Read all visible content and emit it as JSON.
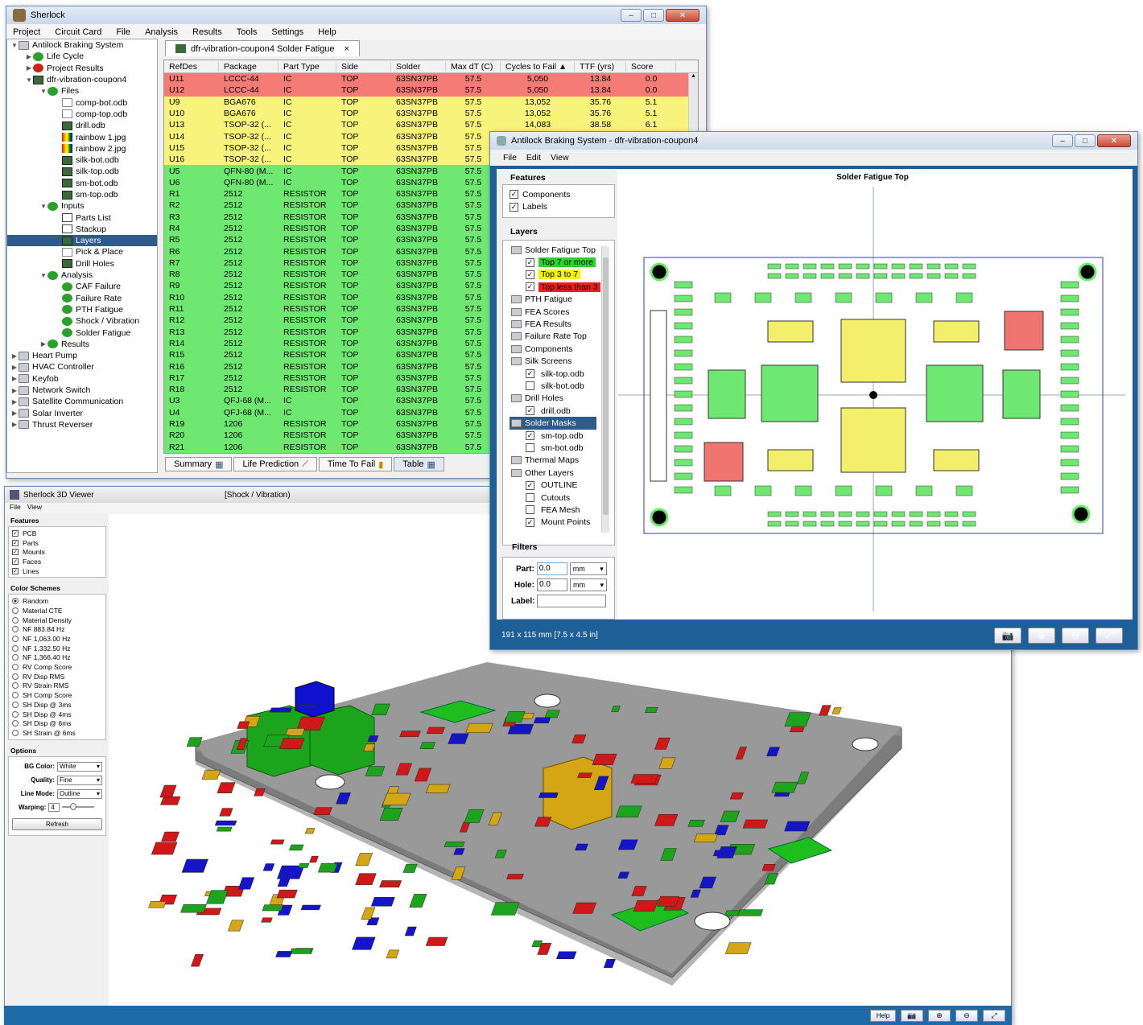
{
  "main_window": {
    "title": "Sherlock",
    "menu": [
      "Project",
      "Circuit Card",
      "File",
      "Analysis",
      "Results",
      "Tools",
      "Settings",
      "Help"
    ],
    "tab_title": "dfr-vibration-coupon4 Solder Fatigue",
    "tab_close": "×",
    "tree": [
      {
        "label": "Antilock Braking System",
        "indent": 0,
        "icon": "folder",
        "tw": "▼"
      },
      {
        "label": "Life Cycle",
        "indent": 1,
        "icon": "ok",
        "tw": "▶"
      },
      {
        "label": "Project Results",
        "indent": 1,
        "icon": "err",
        "tw": "▶"
      },
      {
        "label": "dfr-vibration-coupon4",
        "indent": 1,
        "icon": "board",
        "tw": "▼"
      },
      {
        "label": "Files",
        "indent": 2,
        "icon": "ok",
        "tw": "▼"
      },
      {
        "label": "comp-bot.odb",
        "indent": 3,
        "icon": "file",
        "tw": ""
      },
      {
        "label": "comp-top.odb",
        "indent": 3,
        "icon": "file",
        "tw": ""
      },
      {
        "label": "drill.odb",
        "indent": 3,
        "icon": "board",
        "tw": ""
      },
      {
        "label": "rainbow 1.jpg",
        "indent": 3,
        "icon": "img",
        "tw": ""
      },
      {
        "label": "rainbow 2.jpg",
        "indent": 3,
        "icon": "img",
        "tw": ""
      },
      {
        "label": "silk-bot.odb",
        "indent": 3,
        "icon": "board",
        "tw": ""
      },
      {
        "label": "silk-top.odb",
        "indent": 3,
        "icon": "board",
        "tw": ""
      },
      {
        "label": "sm-bot.odb",
        "indent": 3,
        "icon": "board",
        "tw": ""
      },
      {
        "label": "sm-top.odb",
        "indent": 3,
        "icon": "board",
        "tw": ""
      },
      {
        "label": "Inputs",
        "indent": 2,
        "icon": "ok",
        "tw": "▼"
      },
      {
        "label": "Parts List",
        "indent": 3,
        "icon": "tbl",
        "tw": ""
      },
      {
        "label": "Stackup",
        "indent": 3,
        "icon": "tbl",
        "tw": ""
      },
      {
        "label": "Layers",
        "indent": 3,
        "icon": "board",
        "tw": "",
        "selected": true
      },
      {
        "label": "Pick & Place",
        "indent": 3,
        "icon": "file",
        "tw": ""
      },
      {
        "label": "Drill Holes",
        "indent": 3,
        "icon": "board",
        "tw": ""
      },
      {
        "label": "Analysis",
        "indent": 2,
        "icon": "ok",
        "tw": "▼"
      },
      {
        "label": "CAF Failure",
        "indent": 3,
        "icon": "ok",
        "tw": ""
      },
      {
        "label": "Failure Rate",
        "indent": 3,
        "icon": "ok",
        "tw": ""
      },
      {
        "label": "PTH Fatigue",
        "indent": 3,
        "icon": "ok",
        "tw": ""
      },
      {
        "label": "Shock / Vibration",
        "indent": 3,
        "icon": "ok",
        "tw": ""
      },
      {
        "label": "Solder Fatigue",
        "indent": 3,
        "icon": "ok",
        "tw": ""
      },
      {
        "label": "Results",
        "indent": 2,
        "icon": "ok",
        "tw": "▶"
      },
      {
        "label": "Heart Pump",
        "indent": 0,
        "icon": "folder",
        "tw": "▶"
      },
      {
        "label": "HVAC Controller",
        "indent": 0,
        "icon": "folder",
        "tw": "▶"
      },
      {
        "label": "Keyfob",
        "indent": 0,
        "icon": "folder",
        "tw": "▶"
      },
      {
        "label": "Network Switch",
        "indent": 0,
        "icon": "folder",
        "tw": "▶"
      },
      {
        "label": "Satellite Communication",
        "indent": 0,
        "icon": "folder",
        "tw": "▶"
      },
      {
        "label": "Solar Inverter",
        "indent": 0,
        "icon": "folder",
        "tw": "▶"
      },
      {
        "label": "Thrust Reverser",
        "indent": 0,
        "icon": "folder",
        "tw": "▶"
      }
    ],
    "columns": [
      "RefDes",
      "Package",
      "Part Type",
      "Side",
      "Solder",
      "Max dT (C)",
      "Cycles to Fail ▲",
      "TTF (yrs)",
      "Score"
    ],
    "rows": [
      [
        "U11",
        "LCCC-44",
        "IC",
        "TOP",
        "63SN37PB",
        "57.5",
        "5,050",
        "13.84",
        "0.0",
        "red"
      ],
      [
        "U12",
        "LCCC-44",
        "IC",
        "TOP",
        "63SN37PB",
        "57.5",
        "5,050",
        "13.84",
        "0.0",
        "red"
      ],
      [
        "U9",
        "BGA676",
        "IC",
        "TOP",
        "63SN37PB",
        "57.5",
        "13,052",
        "35.76",
        "5.1",
        "yel"
      ],
      [
        "U10",
        "BGA676",
        "IC",
        "TOP",
        "63SN37PB",
        "57.5",
        "13,052",
        "35.76",
        "5.1",
        "yel"
      ],
      [
        "U13",
        "TSOP-32 (...",
        "IC",
        "TOP",
        "63SN37PB",
        "57.5",
        "14,083",
        "38.58",
        "6.1",
        "yel"
      ],
      [
        "U14",
        "TSOP-32 (...",
        "IC",
        "TOP",
        "63SN37PB",
        "57.5",
        "",
        "",
        "",
        "yel"
      ],
      [
        "U15",
        "TSOP-32 (...",
        "IC",
        "TOP",
        "63SN37PB",
        "57.5",
        "",
        "",
        "",
        "yel"
      ],
      [
        "U16",
        "TSOP-32 (...",
        "IC",
        "TOP",
        "63SN37PB",
        "57.5",
        "",
        "",
        "",
        "yel"
      ],
      [
        "U5",
        "QFN-80 (M...",
        "IC",
        "TOP",
        "63SN37PB",
        "57.5",
        "",
        "",
        "",
        "grn"
      ],
      [
        "U6",
        "QFN-80 (M...",
        "IC",
        "TOP",
        "63SN37PB",
        "57.5",
        "",
        "",
        "",
        "grn"
      ],
      [
        "R1",
        "2512",
        "RESISTOR",
        "TOP",
        "63SN37PB",
        "57.5",
        "",
        "",
        "",
        "grn"
      ],
      [
        "R2",
        "2512",
        "RESISTOR",
        "TOP",
        "63SN37PB",
        "57.5",
        "",
        "",
        "",
        "grn"
      ],
      [
        "R3",
        "2512",
        "RESISTOR",
        "TOP",
        "63SN37PB",
        "57.5",
        "",
        "",
        "",
        "grn"
      ],
      [
        "R4",
        "2512",
        "RESISTOR",
        "TOP",
        "63SN37PB",
        "57.5",
        "",
        "",
        "",
        "grn"
      ],
      [
        "R5",
        "2512",
        "RESISTOR",
        "TOP",
        "63SN37PB",
        "57.5",
        "",
        "",
        "",
        "grn"
      ],
      [
        "R6",
        "2512",
        "RESISTOR",
        "TOP",
        "63SN37PB",
        "57.5",
        "",
        "",
        "",
        "grn"
      ],
      [
        "R7",
        "2512",
        "RESISTOR",
        "TOP",
        "63SN37PB",
        "57.5",
        "",
        "",
        "",
        "grn"
      ],
      [
        "R8",
        "2512",
        "RESISTOR",
        "TOP",
        "63SN37PB",
        "57.5",
        "",
        "",
        "",
        "grn"
      ],
      [
        "R9",
        "2512",
        "RESISTOR",
        "TOP",
        "63SN37PB",
        "57.5",
        "",
        "",
        "",
        "grn"
      ],
      [
        "R10",
        "2512",
        "RESISTOR",
        "TOP",
        "63SN37PB",
        "57.5",
        "",
        "",
        "",
        "grn"
      ],
      [
        "R11",
        "2512",
        "RESISTOR",
        "TOP",
        "63SN37PB",
        "57.5",
        "",
        "",
        "",
        "grn"
      ],
      [
        "R12",
        "2512",
        "RESISTOR",
        "TOP",
        "63SN37PB",
        "57.5",
        "",
        "",
        "",
        "grn"
      ],
      [
        "R13",
        "2512",
        "RESISTOR",
        "TOP",
        "63SN37PB",
        "57.5",
        "",
        "",
        "",
        "grn"
      ],
      [
        "R14",
        "2512",
        "RESISTOR",
        "TOP",
        "63SN37PB",
        "57.5",
        "",
        "",
        "",
        "grn"
      ],
      [
        "R15",
        "2512",
        "RESISTOR",
        "TOP",
        "63SN37PB",
        "57.5",
        "",
        "",
        "",
        "grn"
      ],
      [
        "R16",
        "2512",
        "RESISTOR",
        "TOP",
        "63SN37PB",
        "57.5",
        "",
        "",
        "",
        "grn"
      ],
      [
        "R17",
        "2512",
        "RESISTOR",
        "TOP",
        "63SN37PB",
        "57.5",
        "",
        "",
        "",
        "grn"
      ],
      [
        "R18",
        "2512",
        "RESISTOR",
        "TOP",
        "63SN37PB",
        "57.5",
        "",
        "",
        "",
        "grn"
      ],
      [
        "U3",
        "QFJ-68 (M...",
        "IC",
        "TOP",
        "63SN37PB",
        "57.5",
        "",
        "",
        "",
        "grn"
      ],
      [
        "U4",
        "QFJ-68 (M...",
        "IC",
        "TOP",
        "63SN37PB",
        "57.5",
        "",
        "",
        "",
        "grn"
      ],
      [
        "R19",
        "1206",
        "RESISTOR",
        "TOP",
        "63SN37PB",
        "57.5",
        "",
        "",
        "",
        "grn"
      ],
      [
        "R20",
        "1206",
        "RESISTOR",
        "TOP",
        "63SN37PB",
        "57.5",
        "",
        "",
        "",
        "grn"
      ],
      [
        "R21",
        "1206",
        "RESISTOR",
        "TOP",
        "63SN37PB",
        "57.5",
        "",
        "",
        "",
        "grn"
      ]
    ],
    "bottom_tabs": [
      "Summary",
      "Life Prediction",
      "Time To Fail",
      "Table"
    ]
  },
  "layout_window": {
    "title": "Antilock Braking System - dfr-vibration-coupon4",
    "menu": [
      "File",
      "Edit",
      "View"
    ],
    "features_label": "Features",
    "features": [
      {
        "label": "Components",
        "checked": true
      },
      {
        "label": "Labels",
        "checked": true
      }
    ],
    "layers_label": "Layers",
    "layers": [
      {
        "label": "Solder Fatigue Top",
        "kind": "folder"
      },
      {
        "label": "Top 7 or more",
        "kind": "check",
        "checked": true,
        "color": "#2bd42b"
      },
      {
        "label": "Top 3 to 7",
        "kind": "check",
        "checked": true,
        "color": "#f4f400"
      },
      {
        "label": "Top less than 3",
        "kind": "check",
        "checked": true,
        "color": "#f01c1c"
      },
      {
        "label": "PTH Fatigue",
        "kind": "folder"
      },
      {
        "label": "FEA Scores",
        "kind": "folder"
      },
      {
        "label": "FEA Results",
        "kind": "folder"
      },
      {
        "label": "Failure Rate Top",
        "kind": "folder"
      },
      {
        "label": "Components",
        "kind": "folder"
      },
      {
        "label": "Silk Screens",
        "kind": "folder"
      },
      {
        "label": "silk-top.odb",
        "kind": "check",
        "checked": true
      },
      {
        "label": "silk-bot.odb",
        "kind": "check",
        "checked": false
      },
      {
        "label": "Drill Holes",
        "kind": "folder"
      },
      {
        "label": "drill.odb",
        "kind": "check",
        "checked": true
      },
      {
        "label": "Solder Masks",
        "kind": "folder",
        "selected": true
      },
      {
        "label": "sm-top.odb",
        "kind": "check",
        "checked": true
      },
      {
        "label": "sm-bot.odb",
        "kind": "check",
        "checked": false
      },
      {
        "label": "Thermal Maps",
        "kind": "folder"
      },
      {
        "label": "Other Layers",
        "kind": "folder"
      },
      {
        "label": "OUTLINE",
        "kind": "check",
        "checked": true
      },
      {
        "label": "Cutouts",
        "kind": "check",
        "checked": false
      },
      {
        "label": "FEA Mesh",
        "kind": "check",
        "checked": false
      },
      {
        "label": "Mount Points",
        "kind": "check",
        "checked": true
      }
    ],
    "filters_label": "Filters",
    "part_label": "Part:",
    "part_value": "0.0",
    "part_unit": "mm",
    "hole_label": "Hole:",
    "hole_value": "0.0",
    "hole_unit": "mm",
    "label_label": "Label:",
    "label_value": "",
    "canvas_title": "Solder Fatigue Top",
    "status": "191 x 115 mm  [7.5 x 4.5 in]"
  },
  "viewer_window": {
    "title": "Sherlock 3D Viewer",
    "subtitle": "[Shock / Vibration)",
    "menu": [
      "File",
      "View"
    ],
    "features_label": "Features",
    "features": [
      "PCB",
      "Parts",
      "Mounts",
      "Faces",
      "Lines"
    ],
    "schemes_label": "Color Schemes",
    "schemes": [
      "Random",
      "Material CTE",
      "Material Density",
      "NF 883.84 Hz",
      "NF 1,063.00 Hz",
      "NF 1,332.50 Hz",
      "NF 1,366.40 Hz",
      "RV Comp Score",
      "RV Disp RMS",
      "RV Strain RMS",
      "SH Comp Score",
      "SH Disp @ 3ms",
      "SH Disp @ 4ms",
      "SH Disp @ 6ms",
      "SH Strain @ 6ms"
    ],
    "options_label": "Options",
    "bg_label": "BG Color:",
    "bg_value": "White",
    "quality_label": "Quality:",
    "quality_value": "Fine",
    "line_label": "Line Mode:",
    "line_value": "Outline",
    "warp_label": "Warping:",
    "warp_value": "4",
    "refresh_label": "Refresh",
    "help_label": "Help"
  }
}
